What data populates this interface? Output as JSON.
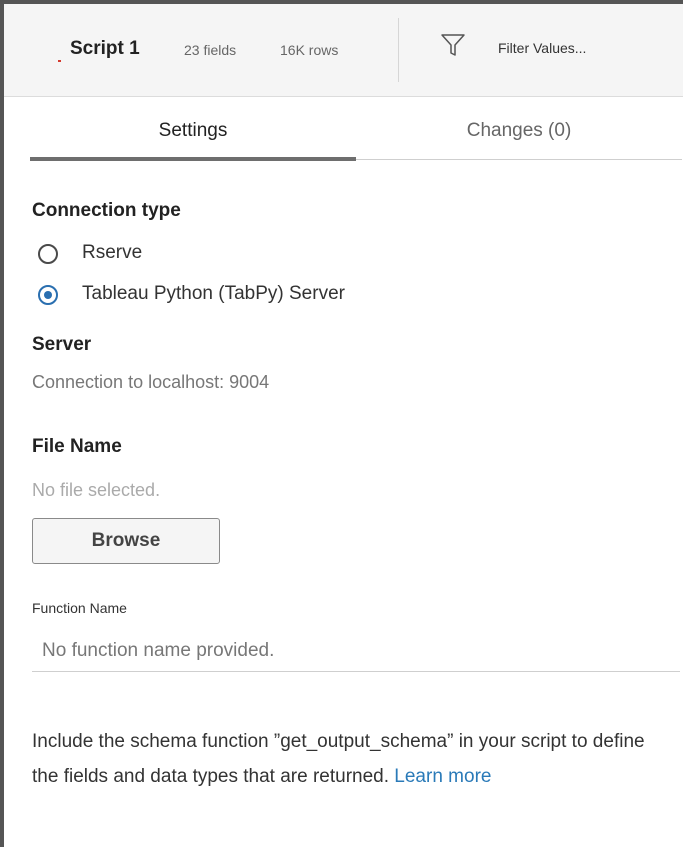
{
  "header": {
    "script_name": "Script 1",
    "field_count": "23 fields",
    "row_count": "16K rows",
    "filter_label": "Filter Values...",
    "accent_mark_color": "#d43a2f"
  },
  "tabs": [
    {
      "label": "Settings",
      "active": true
    },
    {
      "label": "Changes (0)",
      "active": false
    }
  ],
  "connection": {
    "title": "Connection type",
    "options": [
      {
        "label": "Rserve",
        "selected": false
      },
      {
        "label": "Tableau Python (TabPy) Server",
        "selected": true
      }
    ]
  },
  "server": {
    "title": "Server",
    "value": "Connection to localhost: 9004"
  },
  "file": {
    "title": "File Name",
    "placeholder": "No file selected.",
    "browse_label": "Browse"
  },
  "function": {
    "label": "Function Name",
    "placeholder": "No function name provided.",
    "value": ""
  },
  "info": {
    "text": "Include the schema function ”get_output_schema” in your script to define the fields and data types that are returned.",
    "link_text": "Learn more"
  },
  "colors": {
    "link": "#2a7ab8",
    "radio_selected": "#2a6fb0",
    "active_tab_underline": "#6e6e6e"
  }
}
